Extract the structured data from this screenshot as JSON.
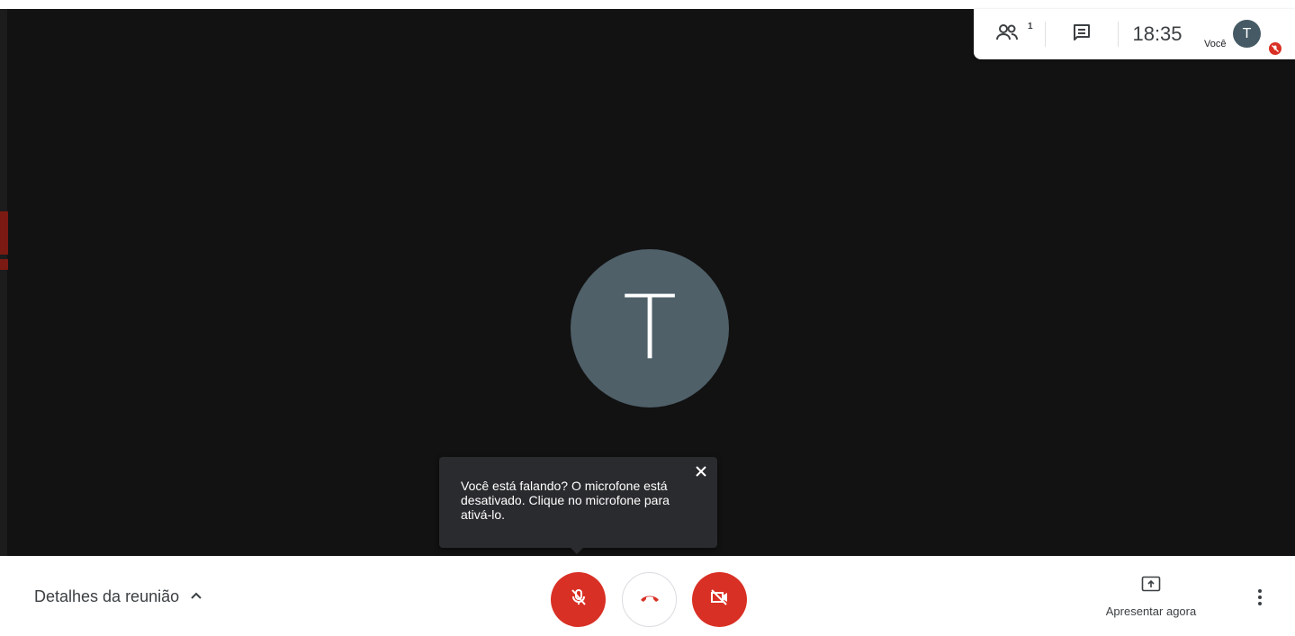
{
  "top_panel": {
    "participants_count": "1",
    "time": "18:35",
    "self_label": "Você",
    "self_initial": "T"
  },
  "main": {
    "avatar_initial": "T"
  },
  "tooltip": {
    "text": "Você está falando? O microfone está desativado. Clique no microfone para ativá-lo."
  },
  "bottom_bar": {
    "details_label": "Detalhes da reunião",
    "present_label": "Apresentar agora"
  },
  "colors": {
    "stage_bg": "#121212",
    "avatar_bg": "#4f6069",
    "danger": "#d93025",
    "tooltip_bg": "#2a2b2e"
  },
  "icons": [
    "people-icon",
    "chat-icon",
    "mic-off-icon",
    "hang-up-icon",
    "camera-off-icon",
    "present-screen-icon",
    "more-vertical-icon",
    "close-icon",
    "chevron-up-icon"
  ]
}
